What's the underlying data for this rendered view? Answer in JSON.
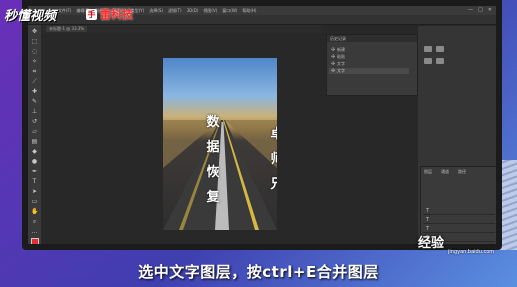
{
  "watermark": {
    "brand": "秒懂视频",
    "channel_icon": "手",
    "channel": "雷科技",
    "baidu": "经验",
    "baidu_url": "jingyan.baidu.com"
  },
  "subtitle": "选中文字图层，按ctrl+E合并图层",
  "photoshop": {
    "menus": [
      "文件(F)",
      "编辑(E)",
      "图像(I)",
      "图层(L)",
      "类型(Y)",
      "选择(S)",
      "滤镜(T)",
      "3D(D)",
      "视图(V)",
      "窗口(W)",
      "帮助(H)"
    ],
    "window_controls": [
      "—",
      "□",
      "✕"
    ],
    "doc_tab": "未标题-1 @ 33.3%",
    "history_panel": {
      "title": "历史记录",
      "rows": [
        "新建",
        "粘贴",
        "文字",
        "文字"
      ]
    },
    "layers_panel": {
      "tabs": [
        "图层",
        "通道",
        "路径"
      ],
      "rows": [
        "T",
        "T",
        "T",
        "T"
      ]
    },
    "canvas_text": {
      "left_column": "数据恢复",
      "right_column": "卓师兄"
    }
  }
}
